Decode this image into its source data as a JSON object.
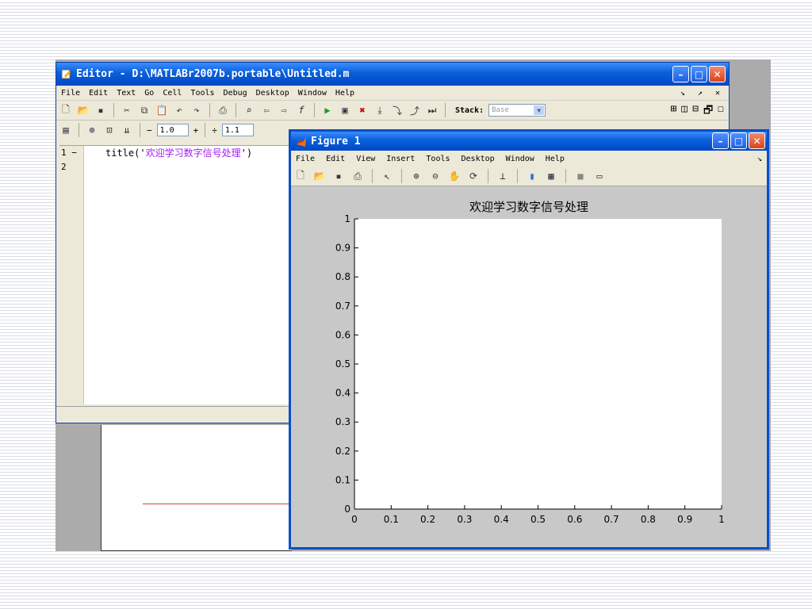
{
  "editor": {
    "title": "Editor - D:\\MATLABr2007b.portable\\Untitled.m",
    "menu": [
      "File",
      "Edit",
      "Text",
      "Go",
      "Cell",
      "Tools",
      "Debug",
      "Desktop",
      "Window",
      "Help"
    ],
    "stack_label": "Stack:",
    "stack_value": "Base",
    "cell_minus": "−",
    "cell_value_1": "1.0",
    "cell_plus": "+",
    "cell_divide": "÷",
    "cell_value_2": "1.1",
    "lines": [
      {
        "num": "1 −",
        "code_prefix": "title('",
        "code_string": "欢迎学习数字信号处理",
        "code_suffix": "')"
      },
      {
        "num": "2",
        "code_prefix": "",
        "code_string": "",
        "code_suffix": ""
      }
    ]
  },
  "figure": {
    "title": "Figure 1",
    "menu": [
      "File",
      "Edit",
      "View",
      "Insert",
      "Tools",
      "Desktop",
      "Window",
      "Help"
    ]
  },
  "chart_data": {
    "type": "line",
    "title": "欢迎学习数字信号处理",
    "xlim": [
      0,
      1
    ],
    "ylim": [
      0,
      1
    ],
    "xticks": [
      "0",
      "0.1",
      "0.2",
      "0.3",
      "0.4",
      "0.5",
      "0.6",
      "0.7",
      "0.8",
      "0.9",
      "1"
    ],
    "yticks": [
      "0",
      "0.1",
      "0.2",
      "0.3",
      "0.4",
      "0.5",
      "0.6",
      "0.7",
      "0.8",
      "0.9",
      "1"
    ],
    "series": [],
    "grid": false
  }
}
